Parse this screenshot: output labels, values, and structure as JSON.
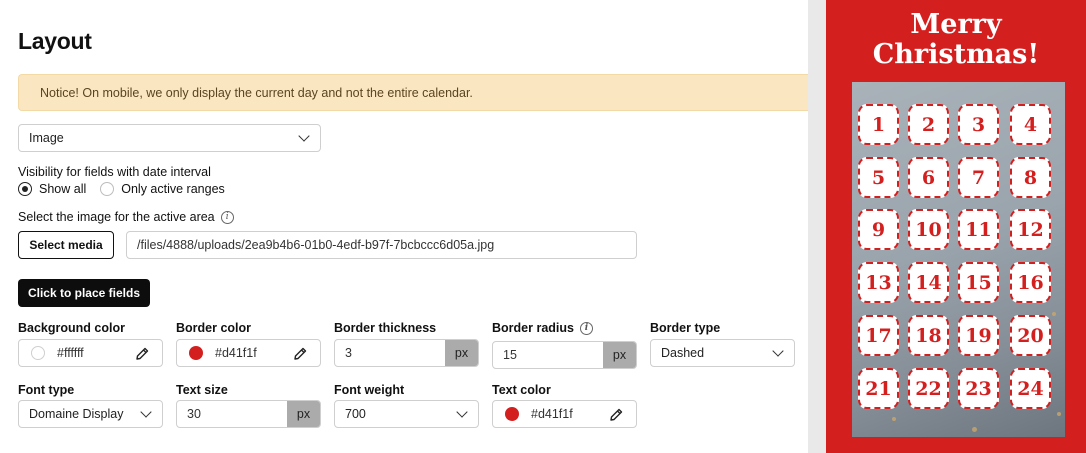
{
  "page": {
    "title": "Layout"
  },
  "notice": {
    "text": "Notice! On mobile, we only display the current day and not the entire calendar."
  },
  "layout_select": {
    "value": "Image"
  },
  "visibility": {
    "label": "Visibility for fields with date interval",
    "options": [
      {
        "label": "Show all",
        "checked": true
      },
      {
        "label": "Only active ranges",
        "checked": false
      }
    ]
  },
  "image_select": {
    "label": "Select the image for the active area",
    "button_label": "Select media",
    "path": "/files/4888/uploads/2ea9b4b6-01b0-4edf-b97f-7bcbccc6d05a.jpg"
  },
  "place_fields": {
    "button_label": "Click to place fields"
  },
  "background_color": {
    "label": "Background color",
    "value": "#ffffff"
  },
  "border_color": {
    "label": "Border color",
    "value": "#d41f1f"
  },
  "border_thickness": {
    "label": "Border thickness",
    "value": "3",
    "unit": "px"
  },
  "border_radius": {
    "label": "Border radius",
    "value": "15",
    "unit": "px"
  },
  "border_type": {
    "label": "Border type",
    "value": "Dashed"
  },
  "font_type": {
    "label": "Font type",
    "value": "Domaine Display"
  },
  "text_size": {
    "label": "Text size",
    "value": "30",
    "unit": "px"
  },
  "font_weight": {
    "label": "Font weight",
    "value": "700"
  },
  "text_color": {
    "label": "Text color",
    "value": "#d41f1f"
  },
  "preview": {
    "title_line1": "Merry",
    "title_line2": "Christmas!",
    "days": [
      "1",
      "2",
      "3",
      "4",
      "5",
      "6",
      "7",
      "8",
      "9",
      "10",
      "11",
      "12",
      "13",
      "14",
      "15",
      "16",
      "17",
      "18",
      "19",
      "20",
      "21",
      "22",
      "23",
      "24"
    ]
  },
  "colors": {
    "accent": "#d41f1f",
    "notice_bg": "#fbe6c2"
  }
}
